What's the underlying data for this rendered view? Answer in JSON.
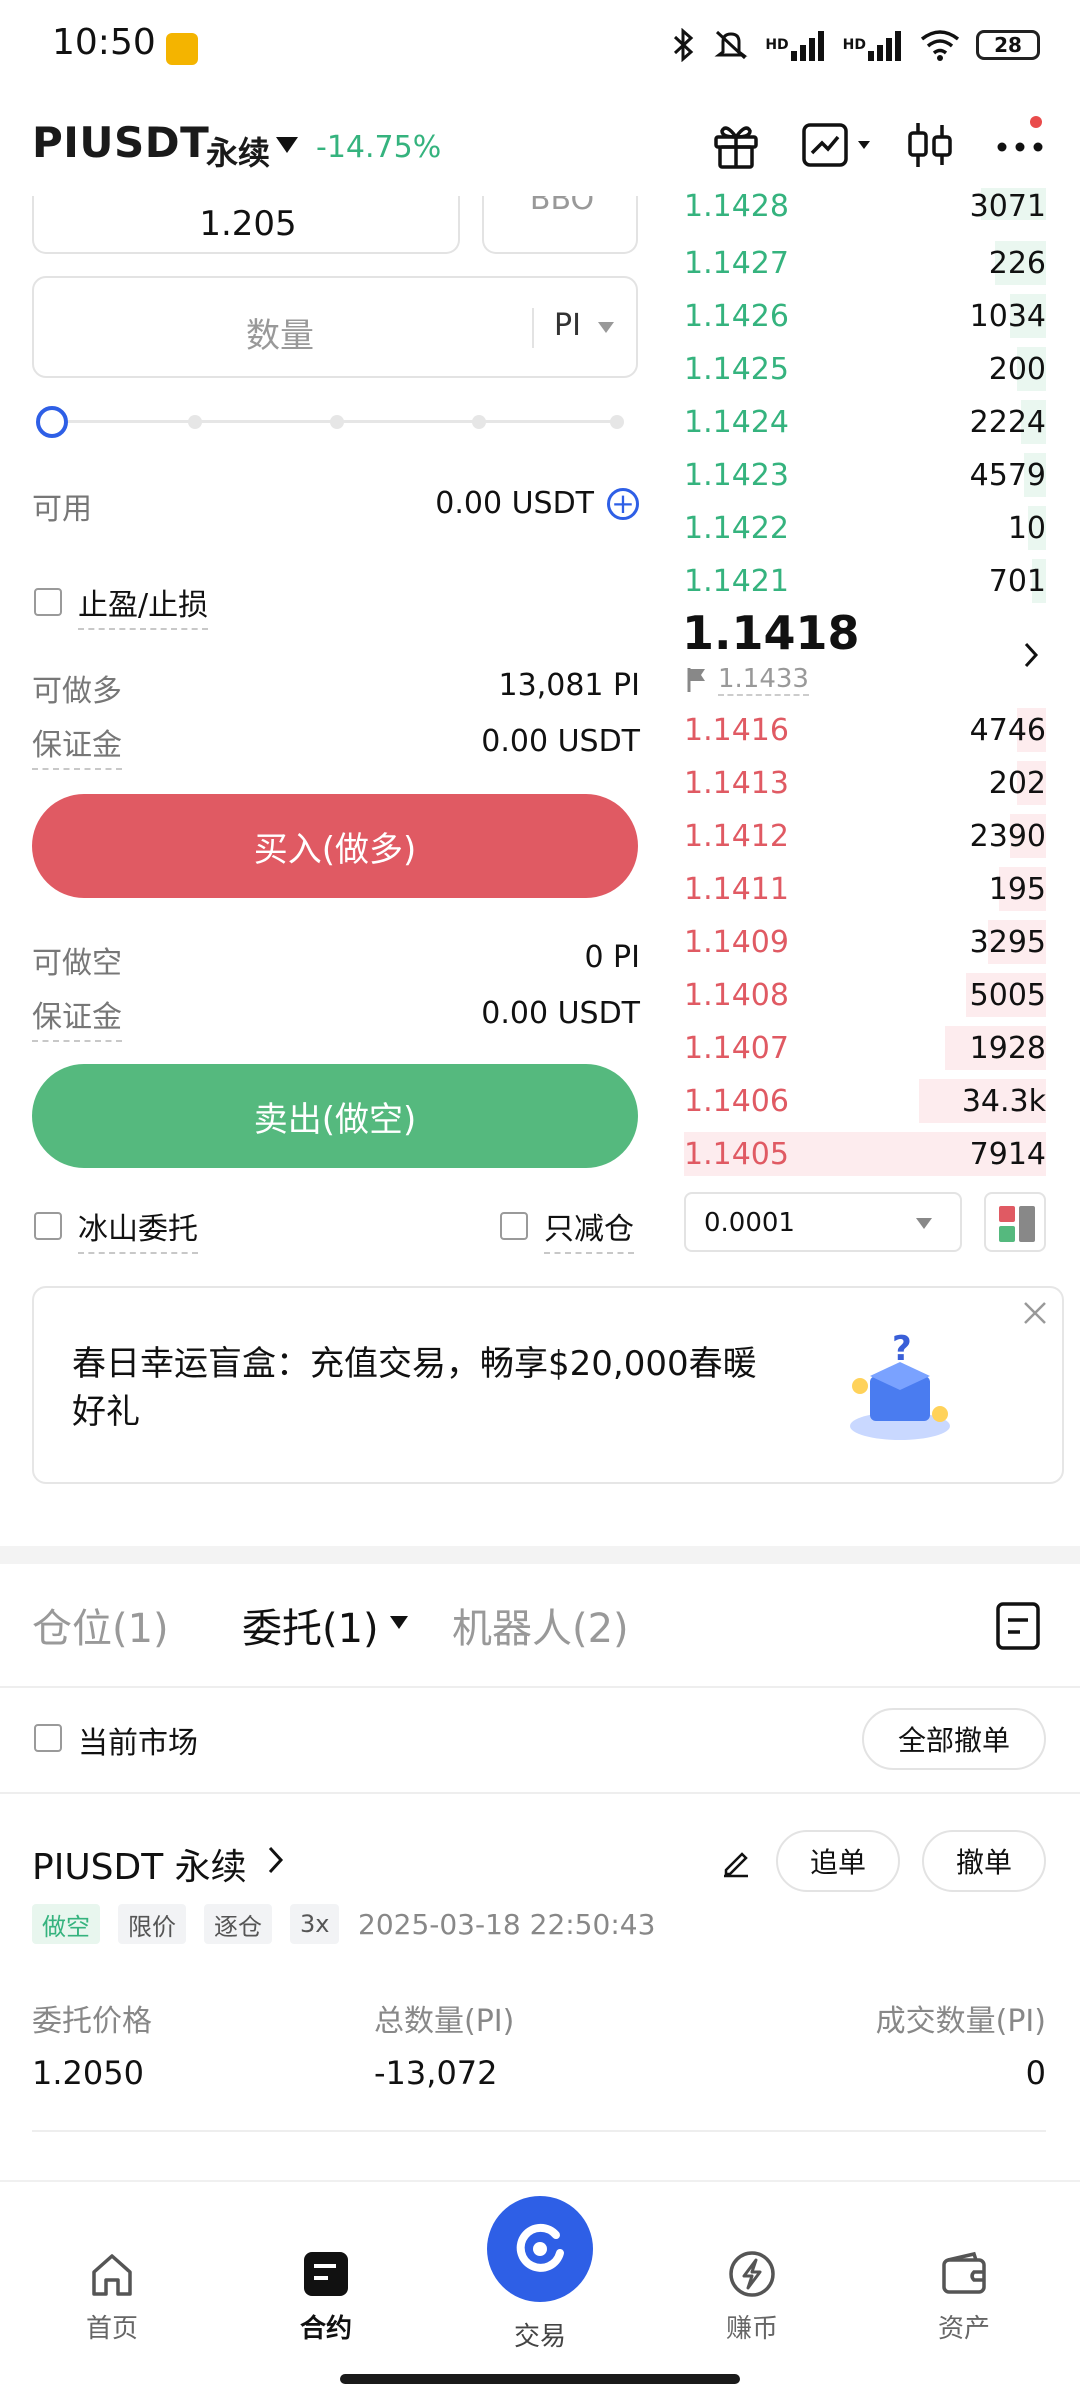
{
  "status": {
    "time": "10:50",
    "battery": "28",
    "hd1": "HD",
    "hd2": "HD"
  },
  "header": {
    "pair": "PIUSDT",
    "contract_type": "永续",
    "change": "-14.75%"
  },
  "form": {
    "price": "1.205",
    "bbo": "BBO",
    "quantity_placeholder": "数量",
    "quantity_unit": "PI",
    "available_label": "可用",
    "available_value": "0.00 USDT",
    "tpsl_label": "止盈/止损",
    "long_max_label": "可做多",
    "long_max_value": "13,081 PI",
    "margin_label": "保证金",
    "long_margin_value": "0.00 USDT",
    "buy_button": "买入(做多)",
    "short_max_label": "可做空",
    "short_max_value": "0 PI",
    "short_margin_value": "0.00 USDT",
    "sell_button": "卖出(做空)",
    "iceberg_label": "冰山委托",
    "reduce_only_label": "只减仓"
  },
  "orderbook": {
    "asks": [
      {
        "price": "1.1428",
        "qty": "3071",
        "depth": 0.18
      },
      {
        "price": "1.1427",
        "qty": "226",
        "depth": 0.14
      },
      {
        "price": "1.1426",
        "qty": "1034",
        "depth": 0.1
      },
      {
        "price": "1.1425",
        "qty": "200",
        "depth": 0.08
      },
      {
        "price": "1.1424",
        "qty": "2224",
        "depth": 0.07
      },
      {
        "price": "1.1423",
        "qty": "4579",
        "depth": 0.06
      },
      {
        "price": "1.1422",
        "qty": "10",
        "depth": 0.05
      },
      {
        "price": "1.1421",
        "qty": "701",
        "depth": 0.04
      }
    ],
    "last_price": "1.1418",
    "mark_price": "1.1433",
    "bids": [
      {
        "price": "1.1416",
        "qty": "4746",
        "depth": 0.08
      },
      {
        "price": "1.1413",
        "qty": "202",
        "depth": 0.08
      },
      {
        "price": "1.1412",
        "qty": "2390",
        "depth": 0.1
      },
      {
        "price": "1.1411",
        "qty": "195",
        "depth": 0.13
      },
      {
        "price": "1.1409",
        "qty": "3295",
        "depth": 0.16
      },
      {
        "price": "1.1408",
        "qty": "5005",
        "depth": 0.22
      },
      {
        "price": "1.1407",
        "qty": "1928",
        "depth": 0.28
      },
      {
        "price": "1.1406",
        "qty": "34.3k",
        "depth": 0.35
      },
      {
        "price": "1.1405",
        "qty": "7914",
        "depth": 1.0
      }
    ],
    "precision": "0.0001"
  },
  "banner": {
    "text": "春日幸运盲盒：充值交易，畅享$20,000春暖好礼"
  },
  "tabs": {
    "positions": "仓位(1)",
    "orders": "委托(1)",
    "bots": "机器人(2)"
  },
  "filters": {
    "current_market": "当前市场",
    "cancel_all": "全部撤单"
  },
  "order": {
    "title": "PIUSDT 永续",
    "chase_button": "追单",
    "cancel_button": "撤单",
    "tags": [
      "做空",
      "限价",
      "逐仓",
      "3x"
    ],
    "time": "2025-03-18 22:50:43",
    "price_label": "委托价格",
    "total_label": "总数量(PI)",
    "filled_label": "成交数量(PI)",
    "price_value": "1.2050",
    "total_value": "-13,072",
    "filled_value": "0"
  },
  "nav": {
    "home": "首页",
    "futures": "合约",
    "trade": "交易",
    "earn": "赚币",
    "assets": "资产"
  },
  "colors": {
    "green": "#55b97e",
    "red": "#e05a63",
    "accent": "#2e5fe6"
  }
}
